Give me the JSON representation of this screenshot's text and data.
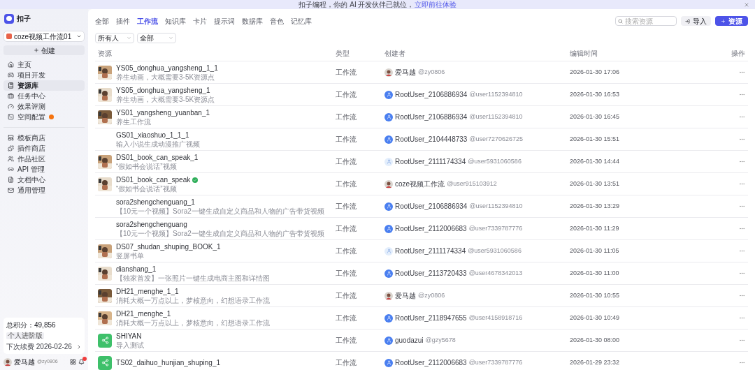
{
  "banner": {
    "text": "扣子编程，你的 AI 开发伙伴已就位，",
    "link": "立即前往体验"
  },
  "logo": {
    "name": "扣子"
  },
  "workspace": "coze视频工作流01",
  "create_button": "创建",
  "nav": [
    {
      "label": "主页",
      "selected": false,
      "alert": false
    },
    {
      "label": "项目开发",
      "selected": false,
      "alert": false
    },
    {
      "label": "资源库",
      "selected": true,
      "alert": false
    },
    {
      "label": "任务中心",
      "selected": false,
      "alert": false
    },
    {
      "label": "效果评测",
      "selected": false,
      "alert": false
    },
    {
      "label": "空间配置",
      "selected": false,
      "alert": true
    }
  ],
  "nav2": [
    {
      "label": "模板商店",
      "selected": false
    },
    {
      "label": "插件商店",
      "selected": false
    },
    {
      "label": "作品社区",
      "selected": false
    },
    {
      "label": "API 管理",
      "selected": false
    },
    {
      "label": "文档中心",
      "selected": false
    },
    {
      "label": "通用管理",
      "selected": false
    }
  ],
  "points": {
    "total": "总积分：49,856",
    "plan": "个人进阶版",
    "renewal": "下次续费 2026-02-26"
  },
  "user": {
    "name": "爱马越",
    "handle": "@zy0806"
  },
  "tabs": [
    {
      "label": "全部",
      "selected": false
    },
    {
      "label": "插件",
      "selected": false
    },
    {
      "label": "工作流",
      "selected": true
    },
    {
      "label": "知识库",
      "selected": false
    },
    {
      "label": "卡片",
      "selected": false
    },
    {
      "label": "提示词",
      "selected": false
    },
    {
      "label": "数据库",
      "selected": false
    },
    {
      "label": "音色",
      "selected": false
    },
    {
      "label": "记忆库",
      "selected": false
    }
  ],
  "filters": [
    {
      "value": "所有人"
    },
    {
      "value": "全部"
    }
  ],
  "search": {
    "placeholder": "搜索资源"
  },
  "import_button": "导入",
  "add_button": "资源",
  "columns": [
    "资源",
    "类型",
    "创建者",
    "编辑时间",
    "操作"
  ],
  "rows": [
    {
      "kind": "picture",
      "title": "YS05_donghua_yangsheng_1_1",
      "desc": "养生动画，大概需要3-5K资源点",
      "verified": false,
      "type": "工作流",
      "creator": {
        "name": "爱马越",
        "handle": "@zy0806"
      },
      "time": "2026-01-30 17:06"
    },
    {
      "kind": "picture",
      "title": "YS05_donghua_yangsheng_1",
      "desc": "养生动画，大概需要3-5K资源点",
      "verified": false,
      "type": "工作流",
      "creator": {
        "kind": "default",
        "name": "RootUser_2106886934",
        "handle": "@user1152394810"
      },
      "time": "2026-01-30 16:53"
    },
    {
      "kind": "picture",
      "title": "YS01_yangsheng_yuanban_1",
      "desc": "养生工作流",
      "verified": false,
      "type": "工作流",
      "creator": {
        "kind": "default",
        "name": "RootUser_2106886934",
        "handle": "@user1152394810"
      },
      "time": "2026-01-30 16:45"
    },
    {
      "title": "GS01_xiaoshuo_1_1_1",
      "desc": "输入小说生成动漫推广视频",
      "verified": false,
      "type": "工作流",
      "creator": {
        "kind": "default",
        "name": "RootUser_2104448733",
        "handle": "@user7270626725"
      },
      "time": "2026-01-30 15:51"
    },
    {
      "kind": "picture",
      "title": "DS01_book_can_speak_1",
      "desc": "“假如书会说话”视频",
      "verified": false,
      "type": "工作流",
      "creator": {
        "kind": "light",
        "name": "RootUser_2111174334",
        "handle": "@user5931060586"
      },
      "time": "2026-01-30 14:44"
    },
    {
      "kind": "picture",
      "title": "DS01_book_can_speak",
      "desc": "“假如书会说话”视频",
      "verified": true,
      "type": "工作流",
      "creator": {
        "name": "coze视频工作流",
        "handle": "@user915103912"
      },
      "time": "2026-01-30 13:51"
    },
    {
      "title": "sora2shengchenguang_1",
      "desc": "【10元一个视频】Sora2一键生成自定义商品和人物的广告带货视频",
      "verified": false,
      "type": "工作流",
      "creator": {
        "kind": "default",
        "name": "RootUser_2106886934",
        "handle": "@user1152394810"
      },
      "time": "2026-01-30 13:29"
    },
    {
      "title": "sora2shengchenguang",
      "desc": "【10元一个视频】Sora2一键生成自定义商品和人物的广告带货视频",
      "verified": false,
      "type": "工作流",
      "creator": {
        "kind": "default",
        "name": "RootUser_2112006683",
        "handle": "@user7339787776"
      },
      "time": "2026-01-30 11:29"
    },
    {
      "kind": "picture",
      "title": "DS07_shudan_shuping_BOOK_1",
      "desc": "竖屏书单",
      "verified": false,
      "type": "工作流",
      "creator": {
        "kind": "light",
        "name": "RootUser_2111174334",
        "handle": "@user5931060586"
      },
      "time": "2026-01-30 11:05"
    },
    {
      "kind": "picture",
      "title": "dianshang_1",
      "desc": "【独家首发】一张照片一键生成电商主图和详情图",
      "verified": false,
      "type": "工作流",
      "creator": {
        "kind": "default",
        "name": "RootUser_2113720433",
        "handle": "@user4678342013"
      },
      "time": "2026-01-30 11:00"
    },
    {
      "kind": "picture",
      "title": "DH21_menghe_1_1",
      "desc": "消耗大概一万点以上，梦核意向，幻想语录工作流",
      "verified": false,
      "type": "工作流",
      "creator": {
        "name": "爱马越",
        "handle": "@zy0806"
      },
      "time": "2026-01-30 10:55"
    },
    {
      "kind": "picture",
      "title": "DH21_menghe_1",
      "desc": "消耗大概一万点以上，梦核意向，幻想语录工作流",
      "verified": false,
      "type": "工作流",
      "creator": {
        "kind": "default",
        "name": "RootUser_2118947655",
        "handle": "@user4158918716"
      },
      "time": "2026-01-30 10:49"
    },
    {
      "kind": "workflow",
      "title": "SHIYAN",
      "desc": "导入测试",
      "verified": false,
      "type": "工作流",
      "creator": {
        "kind": "default",
        "name": "guodazui",
        "handle": "@gzy5678"
      },
      "time": "2026-01-30 08:00"
    },
    {
      "kind": "workflow",
      "title": "TS02_daihuo_hunjian_shuping_1",
      "verified": false,
      "type": "工作流",
      "creator": {
        "kind": "default",
        "name": "RootUser_2112006683",
        "handle": "@user7339787776"
      },
      "time": "2026-01-29 23:32"
    }
  ]
}
